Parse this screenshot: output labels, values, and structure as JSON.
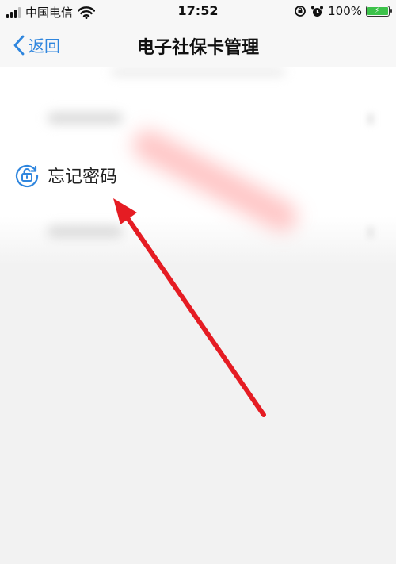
{
  "status_bar": {
    "carrier": "中国电信",
    "time": "17:52",
    "battery_percent": "100%",
    "battery_level": 1.0,
    "charging": true,
    "icons": [
      "signal-icon",
      "wifi-icon",
      "screen-lock-rotation-icon",
      "alarm-icon",
      "battery-icon"
    ]
  },
  "nav": {
    "back_label": "返回",
    "title": "电子社保卡管理"
  },
  "list": {
    "forgot_password_label": "忘记密码",
    "forgot_password_icon": "unlock-icon"
  },
  "colors": {
    "accent": "#2f86de",
    "annotation_arrow": "#e51c23",
    "battery_fill": "#3cc24a",
    "background": "#f2f2f2"
  }
}
